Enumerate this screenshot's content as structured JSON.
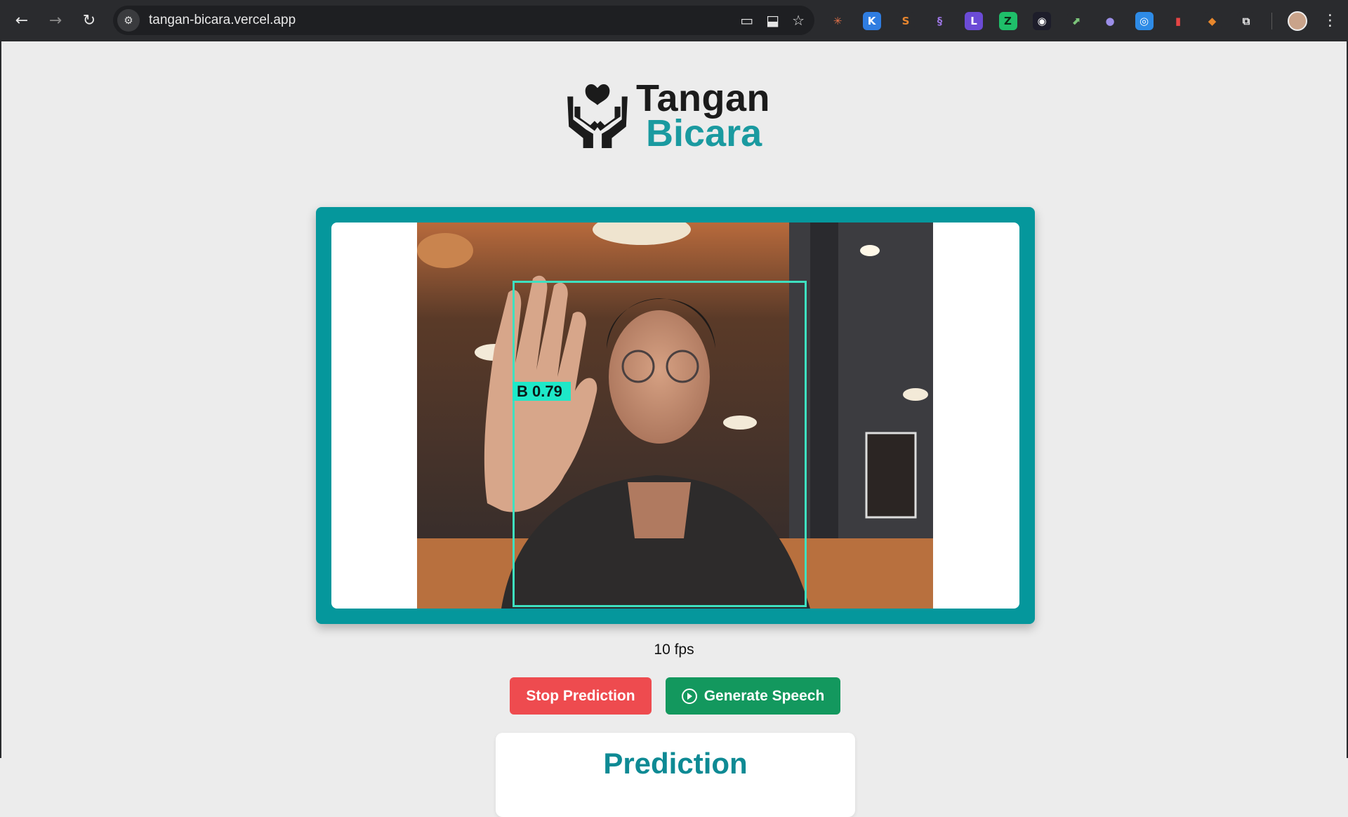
{
  "browser": {
    "url": "tangan-bicara.vercel.app",
    "icons": [
      "back-icon",
      "forward-icon",
      "reload-icon",
      "site-settings-icon",
      "camera-icon",
      "install-icon",
      "bookmark-star-icon",
      "extensions-puzzle-icon",
      "menu-dots-icon"
    ],
    "extensions": [
      {
        "name": "claude-extension-icon",
        "glyph": "✳",
        "bg": "#2a2b2e",
        "fg": "#e5734a"
      },
      {
        "name": "k-extension-icon",
        "glyph": "K",
        "bg": "#2f7de1",
        "fg": "#ffffff"
      },
      {
        "name": "s-extension-icon",
        "glyph": "S",
        "bg": "#2a2b2e",
        "fg": "#e8862e"
      },
      {
        "name": "link-extension-icon",
        "glyph": "§",
        "bg": "#2a2b2e",
        "fg": "#9a74e0"
      },
      {
        "name": "purple-extension-icon",
        "glyph": "L",
        "bg": "#6b4bd6",
        "fg": "#ffffff"
      },
      {
        "name": "green-extension-icon",
        "glyph": "Z",
        "bg": "#1fbf6a",
        "fg": "#0c2a18"
      },
      {
        "name": "bear-extension-icon",
        "glyph": "◉",
        "bg": "#1d1d2a",
        "fg": "#ffffff"
      },
      {
        "name": "leaf-extension-icon",
        "glyph": "⬈",
        "bg": "#2a2b2e",
        "fg": "#7cc47a"
      },
      {
        "name": "ghost-extension-icon",
        "glyph": "●",
        "bg": "#2a2b2e",
        "fg": "#9b8ee8"
      },
      {
        "name": "blue-extension-icon",
        "glyph": "◎",
        "bg": "#2e8be6",
        "fg": "#ffffff"
      },
      {
        "name": "lock-extension-icon",
        "glyph": "▮",
        "bg": "#2a2b2e",
        "fg": "#e64545"
      },
      {
        "name": "fox-extension-icon",
        "glyph": "◆",
        "bg": "#2a2b2e",
        "fg": "#e8872c"
      },
      {
        "name": "puzzle-extension-icon",
        "glyph": "⧉",
        "bg": "#2a2b2e",
        "fg": "#e6e6e6"
      }
    ]
  },
  "logo": {
    "line1": "Tangan",
    "line2": "Bicara",
    "icon": "hands-heart-icon",
    "color_dark": "#1b1b1b",
    "color_accent": "#1a9aa0"
  },
  "camera": {
    "detection_label": "B 0.79",
    "frame_color": "#05979c",
    "box_color": "#3ee0c0"
  },
  "stats": {
    "fps": "10 fps"
  },
  "actions": {
    "stop_label": "Stop Prediction",
    "stop_color": "#ee4b4f",
    "speech_label": "Generate Speech",
    "speech_color": "#13985e",
    "speech_icon": "play-circle-icon"
  },
  "prediction": {
    "title": "Prediction"
  }
}
